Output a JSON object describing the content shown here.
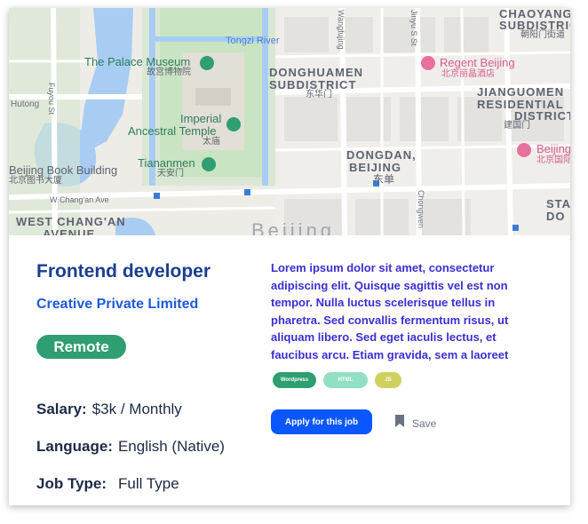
{
  "map": {
    "labels": {
      "chaoyang_en": "CHAOYANG",
      "chaoyang_en2": "SUBDISTRICT",
      "chaoyang_cn": "朝阳门街道",
      "wangfujing": "Wangfujing",
      "jinyu": "Jinyu S St",
      "tongzi_river": "Tongzi River",
      "palace_museum": "The Palace Museum",
      "palace_museum_cn": "故宫博物院",
      "donghuamen_1": "DONGHUAMEN",
      "donghuamen_2": "SUBDISTRICT",
      "donghuamen_cn": "东华门",
      "regent": "Regent Beijing",
      "regent_cn": "北京丽晶酒店",
      "jianguomen_1": "JIANGUOMEN",
      "jianguomen_2": "RESIDENTIAL",
      "jianguomen_3": "DISTRICT",
      "jianguomen_cn": "建国门",
      "fuyou": "Fuyou St",
      "hutong": "Hutong",
      "imperial_1": "Imperial",
      "imperial_2": "Ancestral Temple",
      "imperial_cn": "太庙",
      "tiananmen": "Tiananmen",
      "tiananmen_cn": "天安门",
      "dongdan_1": "DONGDAN,",
      "dongdan_2": "BEIJING",
      "dongdan_cn": "东单",
      "beijing_hotel": "Beijing",
      "beijing_hotel_cn": "北京国际",
      "book_building": "Beijing Book Building",
      "book_building_cn": "北京图书大厦",
      "chang_an": "W Chang'an Ave",
      "chongwen": "Chongwen",
      "west_changan_1": "WEST CHANG'AN",
      "west_changan_2": "AVENUE",
      "beijing_big": "Beijing",
      "sta": "STA",
      "do": "DO"
    }
  },
  "job": {
    "title": "Frontend developer",
    "company": "Creative Private Limited",
    "work_mode": "Remote",
    "salary_label": "Salary:",
    "salary_value": "$3k / Monthly",
    "language_label": "Language:",
    "language_value": "English (Native)",
    "type_label": "Job Type:",
    "type_value": "Full Type",
    "description": "Lorem ipsum dolor sit amet, consectetur adipiscing elit. Quisque sagittis vel est non tempor. Nulla luctus scelerisque tellus in pharetra. Sed convallis fermentum risus, ut aliquam libero. Sed eget iaculis lectus, et faucibus arcu. Etiam gravida, sem a laoreet",
    "tags": [
      "Wordpress",
      "HTML",
      "JS"
    ],
    "apply_label": "Apply for this job",
    "save_label": "Save"
  },
  "colors": {
    "title": "#1a3f8f",
    "company": "#1f5bd6",
    "remote_badge": "#2f9e73",
    "description": "#3b2fd0",
    "apply_button": "#0b57ff",
    "tag_wordpress": "#2f9e73",
    "tag_html": "#93dfc3",
    "tag_js": "#cfd15e"
  }
}
